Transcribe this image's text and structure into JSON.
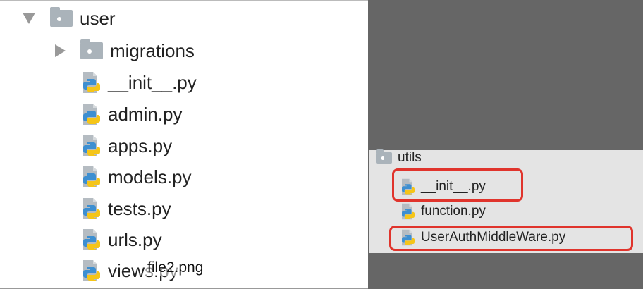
{
  "left_tree": {
    "root": {
      "label": "user",
      "expanded": true
    },
    "items": [
      {
        "label": "migrations",
        "type": "folder",
        "expanded": false
      },
      {
        "label": "__init__.py",
        "type": "python"
      },
      {
        "label": "admin.py",
        "type": "python"
      },
      {
        "label": "apps.py",
        "type": "python"
      },
      {
        "label": "models.py",
        "type": "python"
      },
      {
        "label": "tests.py",
        "type": "python"
      },
      {
        "label": "urls.py",
        "type": "python"
      },
      {
        "label": "views.py",
        "type": "python"
      }
    ]
  },
  "right_tree": {
    "root": {
      "label": "utils"
    },
    "items": [
      {
        "label": "__init__.py",
        "highlighted": true
      },
      {
        "label": "function.py",
        "highlighted": false
      },
      {
        "label": "UserAuthMiddleWare.py",
        "highlighted": true
      }
    ]
  },
  "overlay": {
    "filename": "file2.png"
  },
  "colors": {
    "highlight": "#e0342c",
    "folder": "#aab3ba",
    "python_blue": "#3d8fd1",
    "python_yellow": "#f5c518"
  }
}
